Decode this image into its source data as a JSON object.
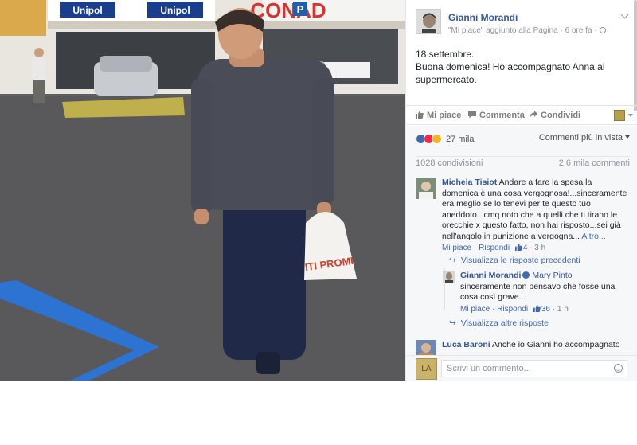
{
  "post": {
    "author": "Gianni Morandi",
    "meta": "\"Mi piace\" aggiunto alla Pagina · 6 ore fa ·",
    "text_line1": "18 settembre.",
    "text_line2": "Buona domenica! Ho accompagnato Anna al supermercato.",
    "image_signs": {
      "sign1": "Unipol",
      "sign2": "Unipol",
      "sign3": "CONAD",
      "parking": "P",
      "bag": "ITI PROMI"
    }
  },
  "actions": {
    "like": "Mi piace",
    "comment": "Commenta",
    "share": "Condividi"
  },
  "stats": {
    "reactions_count": "27 mila",
    "comment_order": "Commenti più in vista",
    "shares": "1028 condivisioni",
    "comments": "2,6 mila commenti"
  },
  "comments": [
    {
      "name": "Michela Tisiot",
      "text": "Andare a fare la spesa la domenica è una cosa vergognosa!...sinceramente era meglio se lo tenevi per te questo tuo aneddoto...cmq noto che a quelli che ti tirano le orecchie x questo fatto, non hai risposto...sei già nell'angolo in punizione a vergogna...",
      "more": "Altro...",
      "like": "Mi piace",
      "reply": "Rispondi",
      "likes": "4",
      "time": "3 h"
    },
    {
      "name": "Gianni Morandi",
      "mention": "Mary Pinto",
      "text": "sinceramente non pensavo che fosse una cosa così grave...",
      "like": "Mi piace",
      "reply": "Rispondi",
      "likes": "36",
      "time": "1 h"
    },
    {
      "name": "Luca Baroni",
      "text": "Anche io Gianni ho accompagnato"
    }
  ],
  "reply_nav": {
    "previous": "Visualizza le risposte precedenti",
    "more": "Visualizza altre risposte"
  },
  "composer": {
    "avatar_label": "LA",
    "placeholder": "Scrivi un commento..."
  }
}
